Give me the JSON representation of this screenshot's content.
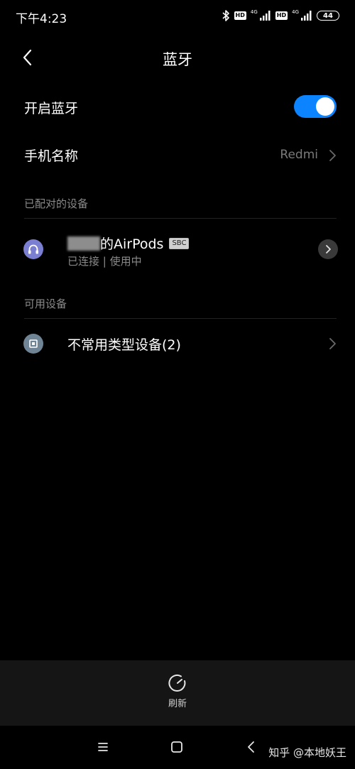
{
  "status_bar": {
    "time": "下午4:23",
    "network_1": "4G",
    "network_2": "4G",
    "hd_1": "HD",
    "hd_2": "HD",
    "battery": "44",
    "icons": [
      "bluetooth-icon",
      "hd-icon",
      "signal-icon",
      "hd-icon",
      "signal-icon",
      "battery-icon"
    ]
  },
  "header": {
    "title": "蓝牙",
    "back_icon": "back-arrow-icon"
  },
  "bluetooth_toggle": {
    "label": "开启蓝牙",
    "enabled": true,
    "color": "#0d84ff"
  },
  "device_name_row": {
    "label": "手机名称",
    "value": "Redmi"
  },
  "paired_section": {
    "header": "已配对的设备",
    "devices": [
      {
        "name_suffix": "的AirPods",
        "codec": "SBC",
        "status": "已连接 | 使用中",
        "icon": "headset-icon",
        "icon_color": "#7b7fd1"
      }
    ]
  },
  "available_section": {
    "header": "可用设备",
    "devices": [
      {
        "name": "不常用类型设备(2)",
        "icon": "device-chip-icon",
        "icon_color": "#6f8494"
      }
    ]
  },
  "bottom_action": {
    "label": "刷新",
    "icon": "refresh-icon"
  },
  "nav_bar": {
    "icons": [
      "menu-icon",
      "home-icon",
      "back-icon"
    ]
  },
  "watermark": "知乎 @本地妖王"
}
